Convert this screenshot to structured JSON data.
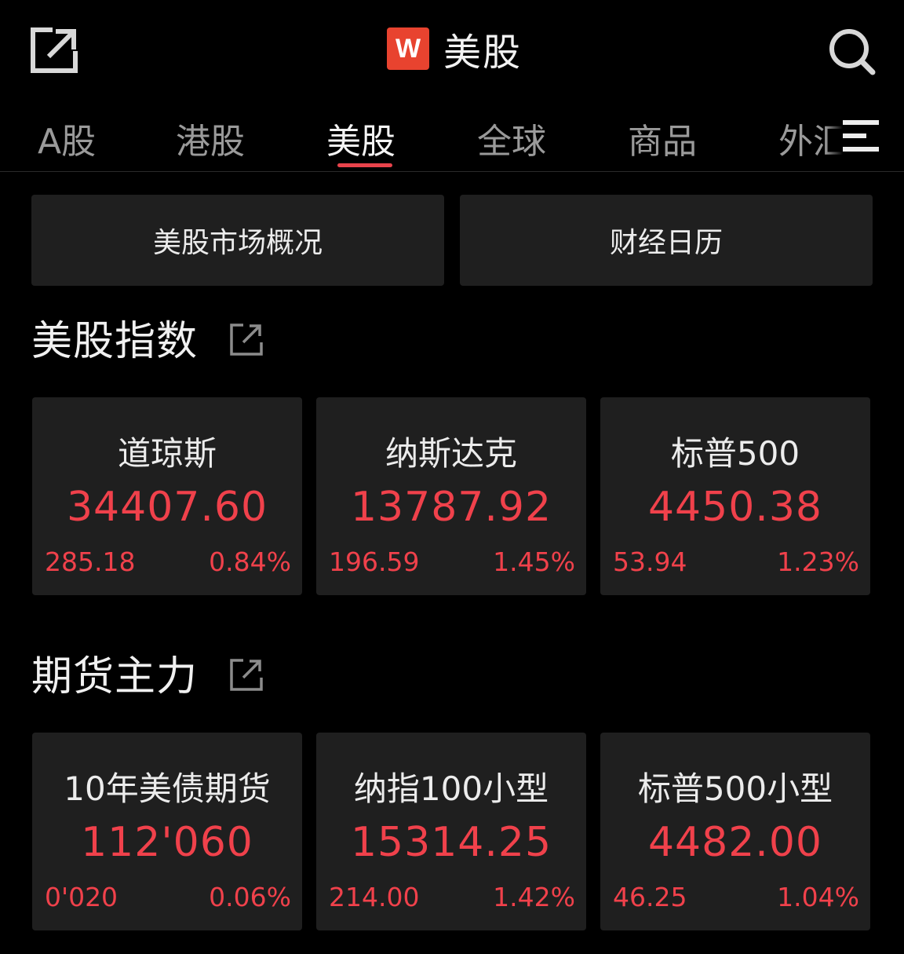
{
  "header": {
    "brand_logo_text": "W",
    "title": "美股",
    "logo_color": "#e8432f"
  },
  "tabs": [
    {
      "label": "A股",
      "active": false
    },
    {
      "label": "港股",
      "active": false
    },
    {
      "label": "美股",
      "active": true
    },
    {
      "label": "全球",
      "active": false
    },
    {
      "label": "商品",
      "active": false
    },
    {
      "label": "外汇",
      "active": false
    }
  ],
  "quick_buttons": [
    {
      "label": "美股市场概况"
    },
    {
      "label": "财经日历"
    }
  ],
  "sections": [
    {
      "title": "美股指数",
      "cards": [
        {
          "name": "道琼斯",
          "price": "34407.60",
          "change": "285.18",
          "pct": "0.84%"
        },
        {
          "name": "纳斯达克",
          "price": "13787.92",
          "change": "196.59",
          "pct": "1.45%"
        },
        {
          "name": "标普500",
          "price": "4450.38",
          "change": "53.94",
          "pct": "1.23%"
        }
      ]
    },
    {
      "title": "期货主力",
      "cards": [
        {
          "name": "10年美债期货",
          "price": "112'060",
          "change": "0'020",
          "pct": "0.06%"
        },
        {
          "name": "纳指100小型",
          "price": "15314.25",
          "change": "214.00",
          "pct": "1.42%"
        },
        {
          "name": "标普500小型",
          "price": "4482.00",
          "change": "46.25",
          "pct": "1.04%"
        }
      ]
    }
  ],
  "colors": {
    "background": "#000000",
    "card_background": "#1f1f1f",
    "up_red": "#f0414b",
    "tab_underline": "#e8434b"
  },
  "icons": {
    "share": "share-icon",
    "search": "search-icon",
    "menu": "menu-icon",
    "external_link": "external-link-icon"
  }
}
